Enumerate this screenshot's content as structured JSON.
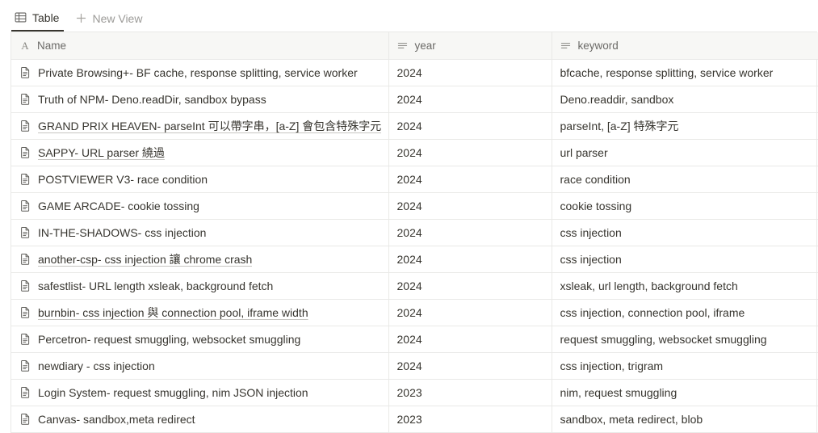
{
  "viewbar": {
    "tabs": [
      {
        "label": "Table",
        "icon": "table-grid-icon",
        "active": true
      },
      {
        "label": "New View",
        "icon": "plus-icon",
        "active": false
      }
    ]
  },
  "table": {
    "columns": [
      {
        "label": "Name",
        "icon": "title-text-icon",
        "type": "title"
      },
      {
        "label": "year",
        "icon": "text-lines-icon",
        "type": "text"
      },
      {
        "label": "keyword",
        "icon": "text-lines-icon",
        "type": "text"
      }
    ],
    "row_icon": "page-document-icon",
    "rows": [
      {
        "name": "Private Browsing+- BF cache, response splitting, service worker",
        "year": "2024",
        "keyword": "bfcache, response splitting, service worker"
      },
      {
        "name": "Truth of NPM- Deno.readDir, sandbox bypass",
        "year": "2024",
        "keyword": "Deno.readdir, sandbox"
      },
      {
        "name": "GRAND PRIX HEAVEN- parseInt 可以帶字串，[a-Z] 會包含特殊字元",
        "year": "2024",
        "keyword": "parseInt, [a-Z] 特殊字元"
      },
      {
        "name": "SAPPY- URL parser 繞過",
        "year": "2024",
        "keyword": "url parser"
      },
      {
        "name": "POSTVIEWER V3- race condition",
        "year": "2024",
        "keyword": "race condition"
      },
      {
        "name": "GAME ARCADE- cookie tossing",
        "year": "2024",
        "keyword": "cookie tossing"
      },
      {
        "name": "IN-THE-SHADOWS- css injection",
        "year": "2024",
        "keyword": "css injection"
      },
      {
        "name": "another-csp- css injection 讓 chrome crash",
        "year": "2024",
        "keyword": "css injection"
      },
      {
        "name": "safestlist- URL length xsleak, background fetch",
        "year": "2024",
        "keyword": "xsleak, url length, background fetch"
      },
      {
        "name": "burnbin- css injection 與 connection pool, iframe width",
        "year": "2024",
        "keyword": "css injection, connection pool, iframe"
      },
      {
        "name": "Percetron- request smuggling, websocket smuggling",
        "year": "2024",
        "keyword": "request smuggling, websocket smuggling"
      },
      {
        "name": "newdiary - css injection",
        "year": "2024",
        "keyword": "css injection, trigram"
      },
      {
        "name": "Login System- request smuggling, nim JSON injection",
        "year": "2023",
        "keyword": "nim, request smuggling"
      },
      {
        "name": "Canvas- sandbox,meta redirect",
        "year": "2023",
        "keyword": "sandbox, meta redirect, blob"
      }
    ]
  },
  "colors": {
    "header_bg": "#f7f7f5",
    "border": "#e9e9e7",
    "text": "#37352f",
    "muted": "#9b9a97"
  }
}
